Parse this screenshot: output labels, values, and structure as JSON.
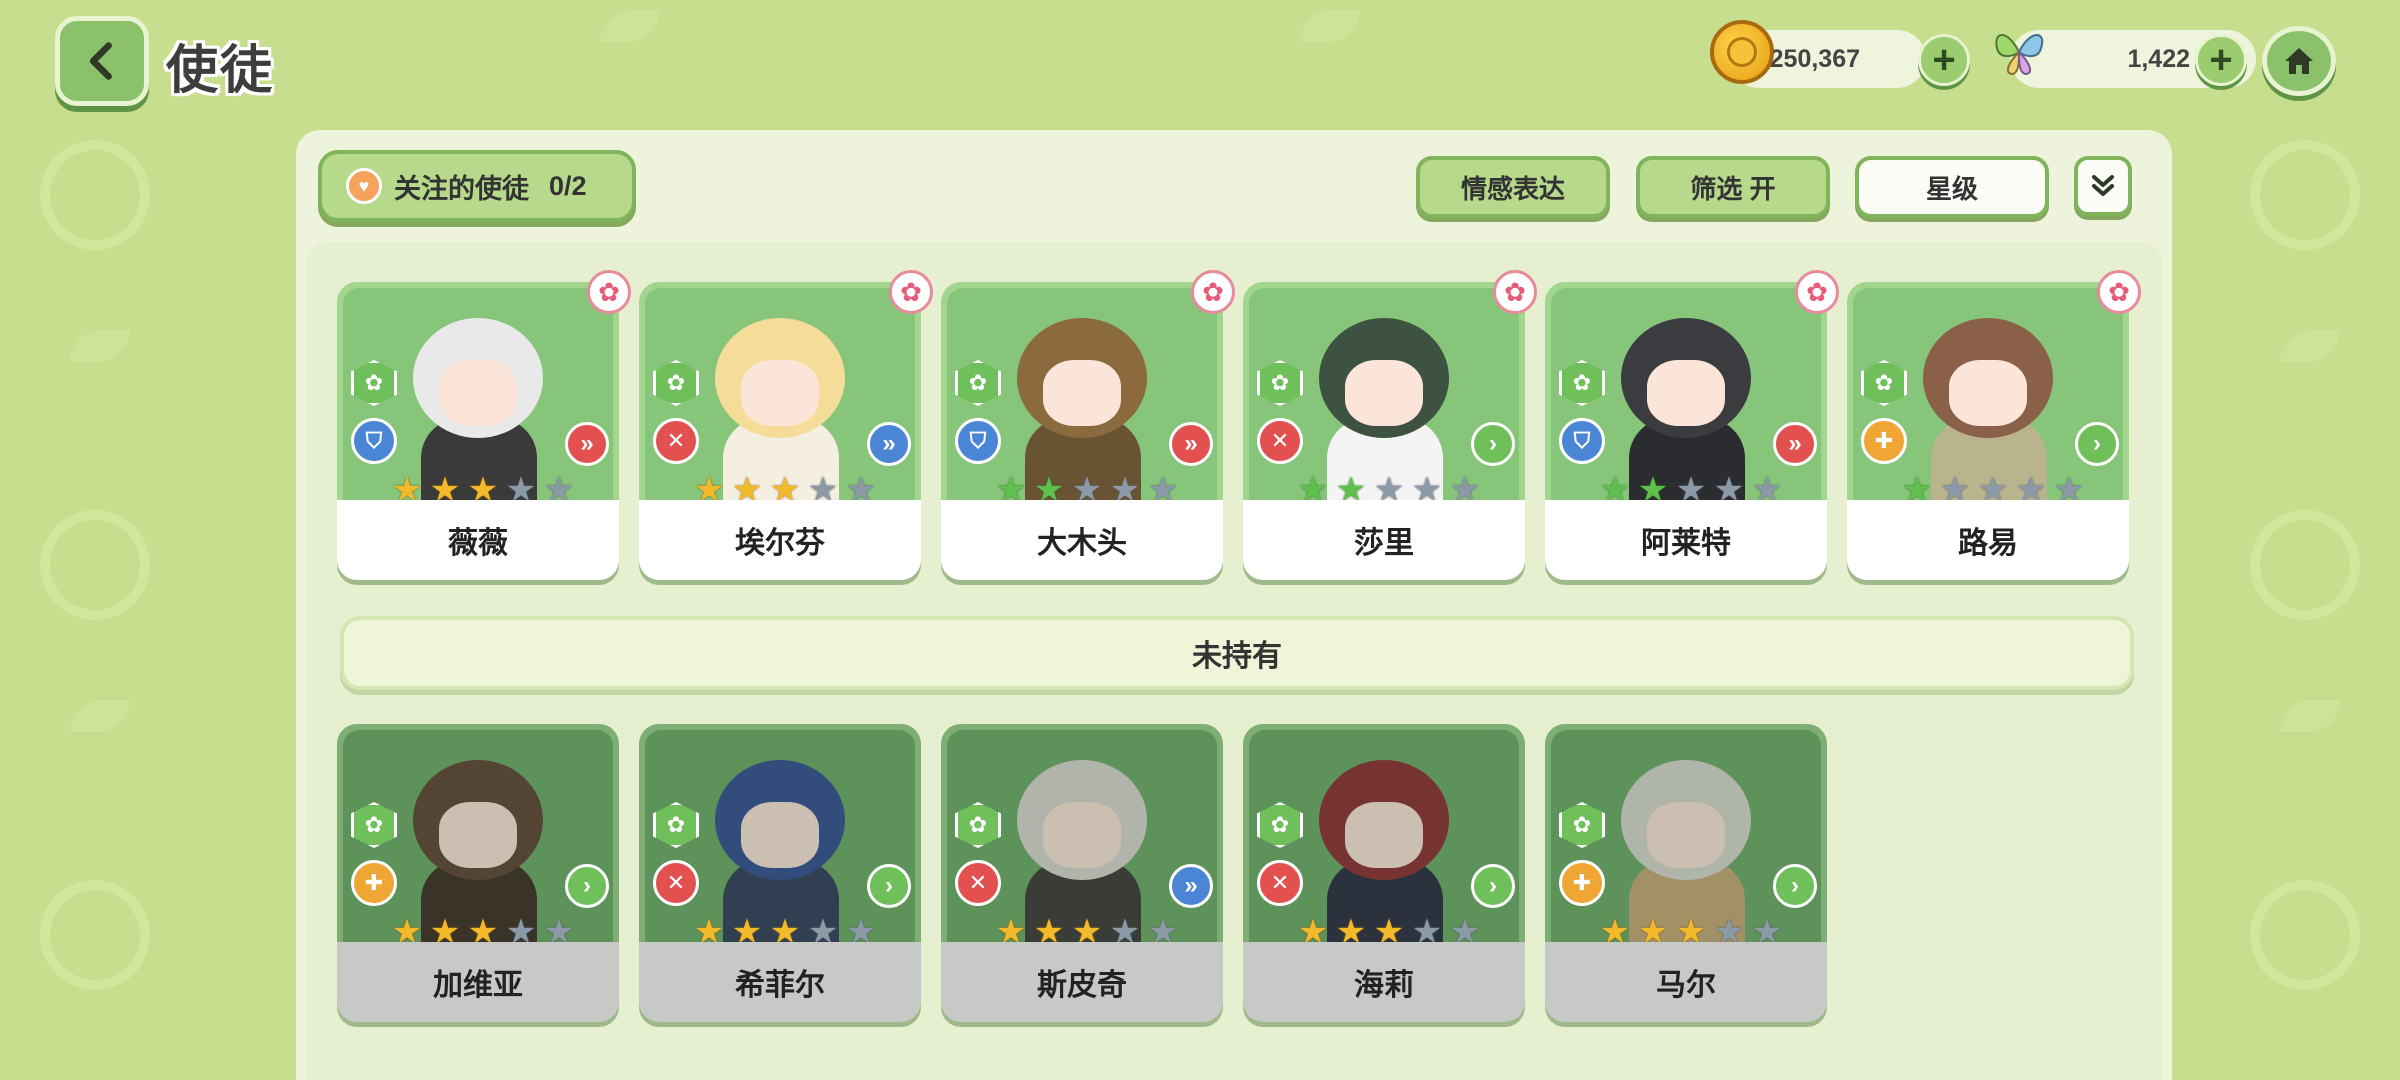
{
  "header": {
    "title": "使徒",
    "gold_amount": "2,250,367",
    "gem_amount": "1,422"
  },
  "toolbar": {
    "follow_label": "关注的使徒",
    "follow_count": "0/2",
    "emotion_label": "情感表达",
    "filter_label": "筛选 开",
    "star_label": "星级"
  },
  "owned": [
    {
      "name": "薇薇",
      "role": "shield",
      "arrow": "red",
      "stars": 3,
      "star_color": "gold",
      "hair": "#e9e9ea",
      "outfit": "#3a3a3a"
    },
    {
      "name": "埃尔芬",
      "role": "sword",
      "arrow": "blue",
      "stars": 3,
      "star_color": "gold",
      "hair": "#f5dc98",
      "outfit": "#f4efe0"
    },
    {
      "name": "大木头",
      "role": "shield",
      "arrow": "red",
      "stars": 2,
      "star_color": "green",
      "hair": "#8b6a3d",
      "outfit": "#6a5332"
    },
    {
      "name": "莎里",
      "role": "sword",
      "arrow": "green",
      "stars": 2,
      "star_color": "green",
      "hair": "#3d5240",
      "outfit": "#f4f4f4"
    },
    {
      "name": "阿莱特",
      "role": "shield",
      "arrow": "red",
      "stars": 2,
      "star_color": "green",
      "hair": "#3b3c40",
      "outfit": "#2b2c30"
    },
    {
      "name": "路易",
      "role": "cross",
      "arrow": "green",
      "stars": 1,
      "star_color": "green",
      "hair": "#8a6148",
      "outfit": "#b9b48e"
    }
  ],
  "section_label": "未持有",
  "not_owned": [
    {
      "name": "加维亚",
      "role": "cross",
      "arrow": "green",
      "stars": 3,
      "star_color": "gold",
      "hair": "#5c4030",
      "outfit": "#3a2a22"
    },
    {
      "name": "希菲尔",
      "role": "sword",
      "arrow": "green",
      "stars": 3,
      "star_color": "gold",
      "hair": "#2f4c92",
      "outfit": "#2c3a58"
    },
    {
      "name": "斯皮奇",
      "role": "sword",
      "arrow": "blue",
      "stars": 3,
      "star_color": "gold",
      "hair": "#d8d6d0",
      "outfit": "#3a3636"
    },
    {
      "name": "海莉",
      "role": "sword",
      "arrow": "green",
      "stars": 3,
      "star_color": "gold",
      "hair": "#8a2a2e",
      "outfit": "#26293e"
    },
    {
      "name": "马尔",
      "role": "cross",
      "arrow": "green",
      "stars": 3,
      "star_color": "gold",
      "hair": "#d7d7cf",
      "outfit": "#c4a776"
    }
  ]
}
